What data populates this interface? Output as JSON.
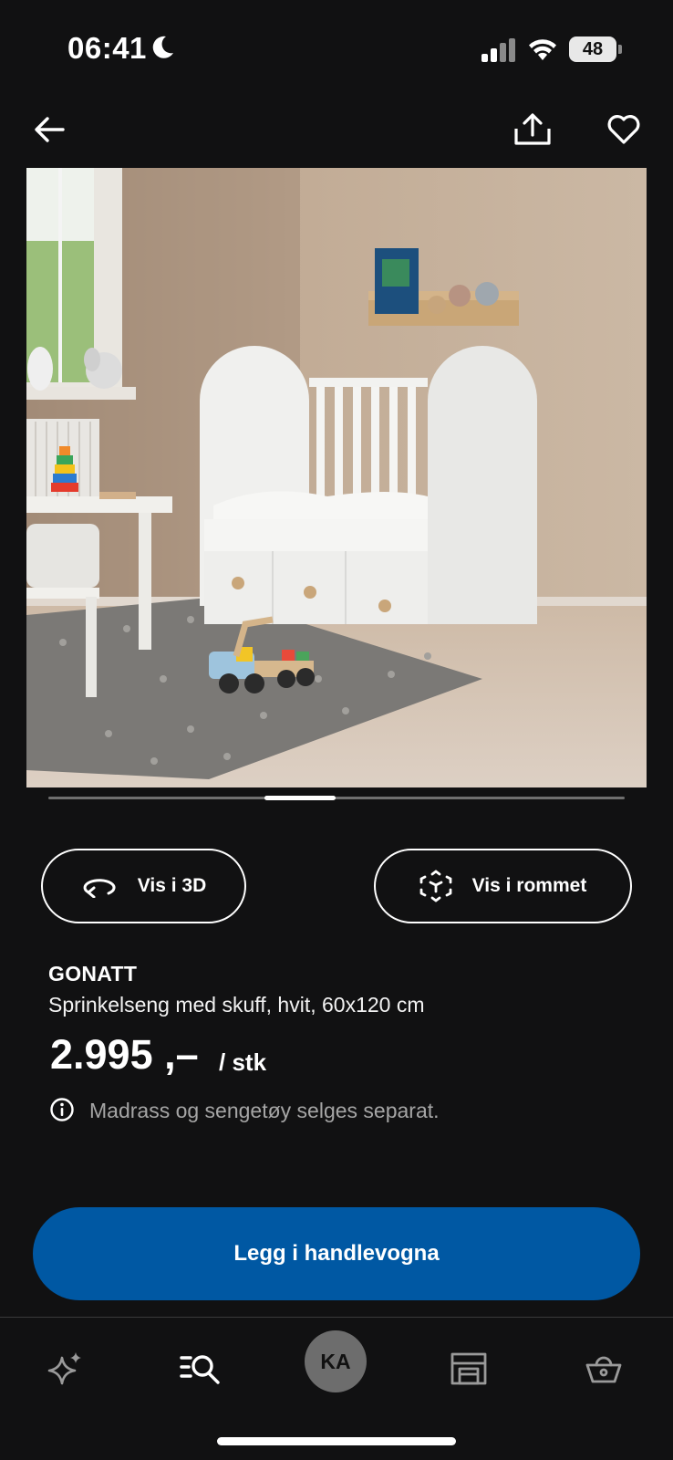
{
  "status_bar": {
    "time": "06:41",
    "battery": "48"
  },
  "nav": {
    "back_icon": "arrow-left-icon",
    "share_icon": "share-icon",
    "favourite_icon": "heart-icon"
  },
  "gallery": {
    "image_description_icon": "product-photo",
    "active_index": 2,
    "total": 8
  },
  "actions": {
    "view_3d": "Vis i 3D",
    "view_in_room": "Vis i rommet"
  },
  "product": {
    "brand": "GONATT",
    "description": "Sprinkelseng med skuff, hvit, 60x120 cm",
    "price": "2.995 ,–",
    "price_unit": "/ stk",
    "info": "Madrass og sengetøy selges separat."
  },
  "cta": {
    "label": "Legg i handlevogna"
  },
  "tabbar": {
    "items": [
      "sparkle-icon",
      "search-list-icon",
      "profile",
      "store-icon",
      "basket-icon"
    ],
    "profile_initials": "KA"
  },
  "colors": {
    "background": "#111112",
    "accent": "#0058a3",
    "muted_text": "#a5a5a5"
  }
}
